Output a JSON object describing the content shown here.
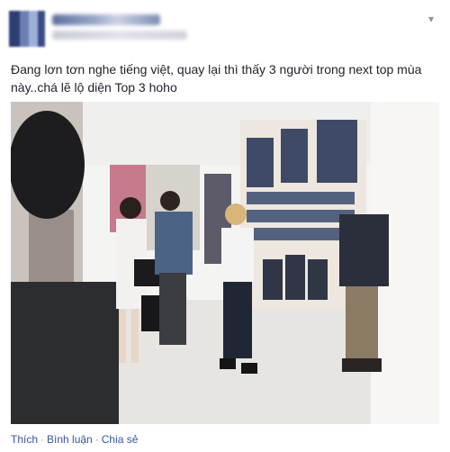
{
  "post": {
    "author_icon": "blurred-avatar",
    "text": "Đang lơn tơn nghe tiếng việt, quay lại thì thấy 3 người trong next top mùa này..chá lẽ lộ diện Top 3 hoho",
    "menu_icon": "chevron-down-icon"
  },
  "actions": {
    "like_label": "Thích",
    "comment_label": "Bình luận",
    "share_label": "Chia sẻ",
    "separator": "·"
  },
  "colors": {
    "link": "#365899",
    "text": "#1d2129",
    "page_bg": "#e9ebee"
  }
}
